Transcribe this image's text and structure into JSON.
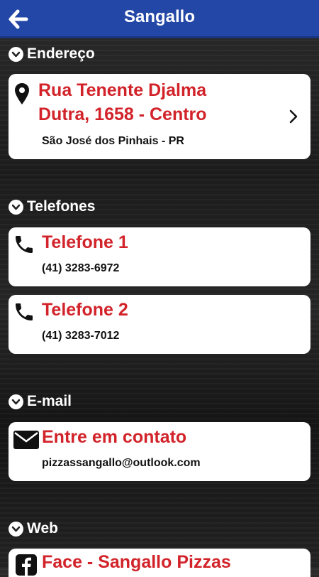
{
  "header": {
    "title": "Sangallo",
    "back_icon": "arrow-left-icon"
  },
  "sections": {
    "address": {
      "label": "Endereço",
      "card": {
        "title_line1": "Rua Tenente Djalma",
        "title_line2": "Dutra, 1658 - Centro",
        "subtitle": "São José dos Pinhais - PR",
        "icon": "map-pin-icon"
      }
    },
    "phones": {
      "label": "Telefones",
      "items": [
        {
          "title": "Telefone 1",
          "number": "(41) 3283-6972",
          "icon": "phone-icon"
        },
        {
          "title": "Telefone 2",
          "number": "(41) 3283-7012",
          "icon": "phone-icon"
        }
      ]
    },
    "email": {
      "label": "E-mail",
      "card": {
        "title": "Entre em contato",
        "address": "pizzassangallo@outlook.com",
        "icon": "envelope-icon"
      }
    },
    "web": {
      "label": "Web",
      "card": {
        "title": "Face - Sangallo Pizzas",
        "icon": "facebook-icon"
      }
    }
  },
  "colors": {
    "header": "#2347a6",
    "accent_red": "#d2232a",
    "card": "#ffffff"
  }
}
